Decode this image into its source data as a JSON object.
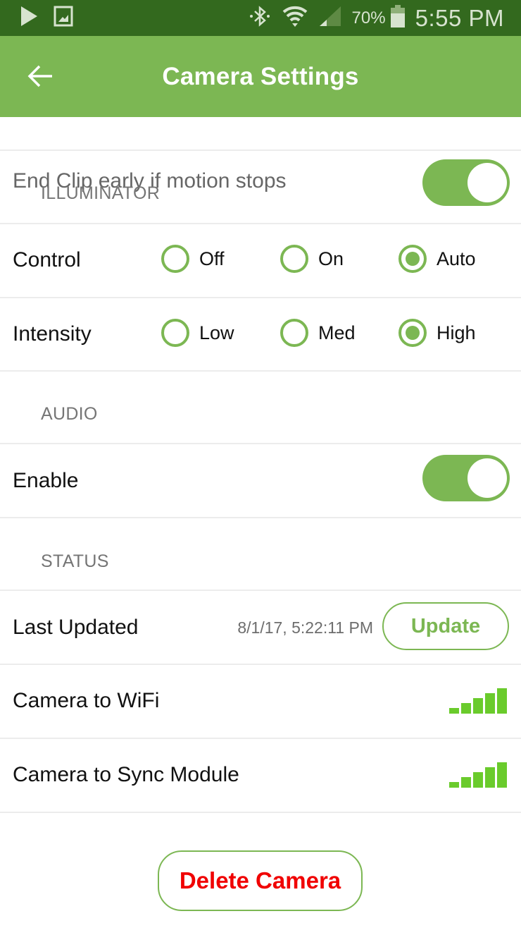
{
  "status_bar": {
    "left_icons": [
      "play-store-icon",
      "gallery-icon"
    ],
    "right_icons": [
      "bluetooth-icon",
      "wifi-icon",
      "cell-signal-icon",
      "battery-icon"
    ],
    "battery": "70%",
    "time": "5:55 PM"
  },
  "app_bar": {
    "back_icon": "arrow-left-icon",
    "title": "Camera Settings"
  },
  "partial_row": {
    "label": "End Clip early if motion stops",
    "toggle_on": true
  },
  "illuminator": {
    "section": "ILLUMINATOR",
    "control": {
      "label": "Control",
      "options": [
        "Off",
        "On",
        "Auto"
      ],
      "selected": "Auto"
    },
    "intensity": {
      "label": "Intensity",
      "options": [
        "Low",
        "Med",
        "High"
      ],
      "selected": "High"
    }
  },
  "audio": {
    "section": "AUDIO",
    "enable": {
      "label": "Enable",
      "toggle_on": true
    }
  },
  "status": {
    "section": "STATUS",
    "last_updated": {
      "label": "Last Updated",
      "value": "8/1/17, 5:22:11 PM",
      "button": "Update"
    },
    "camera_to_wifi": {
      "label": "Camera to WiFi",
      "signal_bars": 5,
      "signal_max": 5
    },
    "camera_to_sync": {
      "label": "Camera to Sync Module",
      "signal_bars": 5,
      "signal_max": 5
    }
  },
  "actions": {
    "delete": "Delete Camera"
  },
  "colors": {
    "status_bar": "#33691e",
    "accent": "#7cb753",
    "signal": "#6acb2c",
    "danger": "#f00000"
  }
}
